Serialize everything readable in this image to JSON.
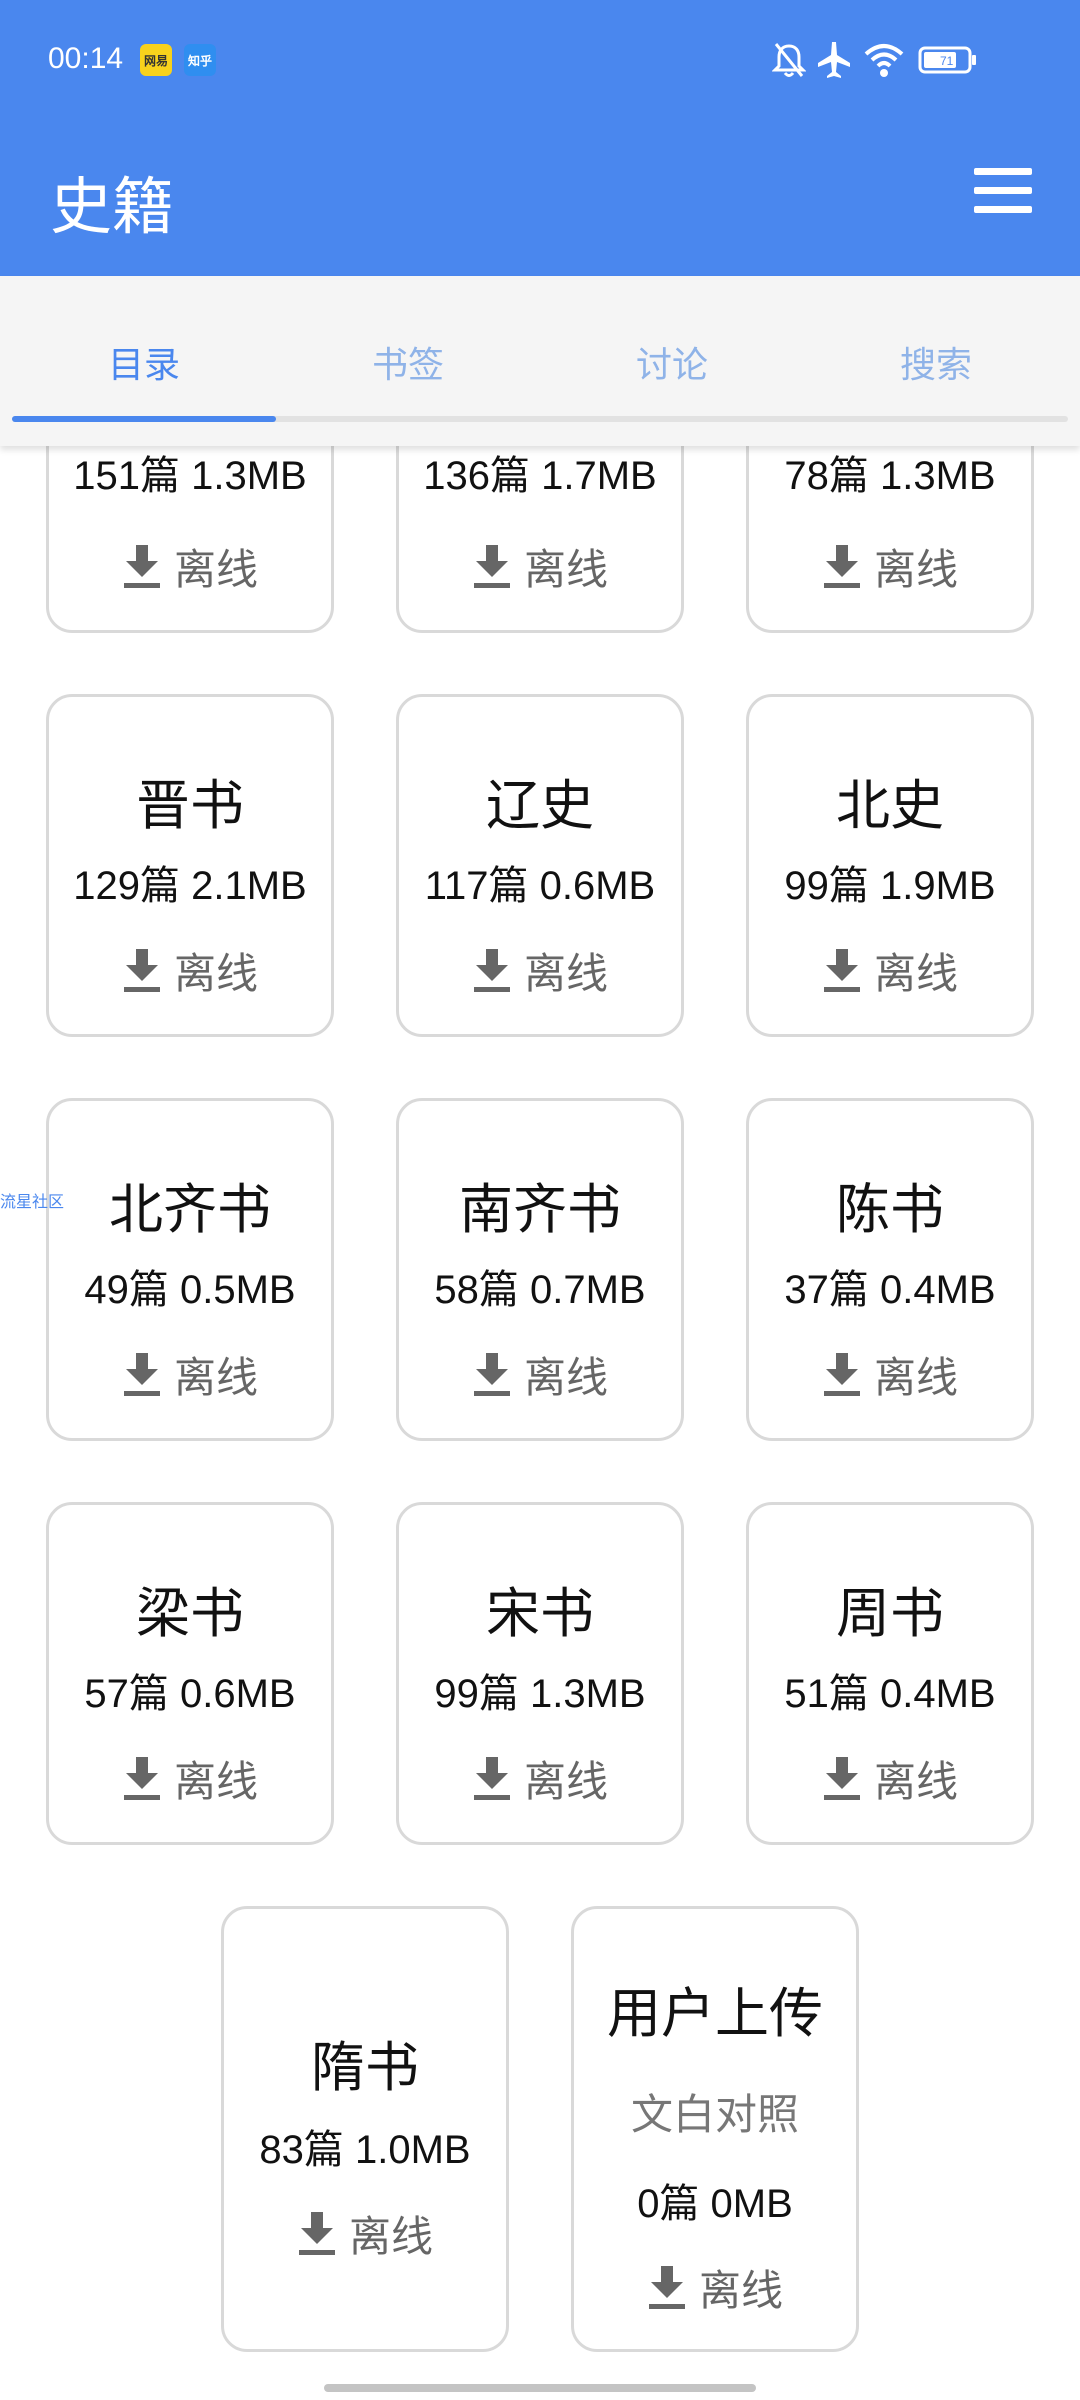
{
  "status_bar": {
    "time": "00:14",
    "app_icons": [
      "网易",
      "知乎"
    ],
    "battery": "71"
  },
  "header": {
    "title": "史籍",
    "menu_icon": "hamburger-icon"
  },
  "tabs": [
    {
      "label": "目录",
      "active": true
    },
    {
      "label": "书签",
      "active": false
    },
    {
      "label": "讨论",
      "active": false
    },
    {
      "label": "搜索",
      "active": false
    }
  ],
  "side_label": "流星社区",
  "download_label": "离线",
  "books": [
    {
      "name": "",
      "meta": "151篇 1.3MB"
    },
    {
      "name": "",
      "meta": "136篇 1.7MB"
    },
    {
      "name": "",
      "meta": "78篇 1.3MB"
    },
    {
      "name": "晋书",
      "meta": "129篇 2.1MB"
    },
    {
      "name": "辽史",
      "meta": "117篇 0.6MB"
    },
    {
      "name": "北史",
      "meta": "99篇 1.9MB"
    },
    {
      "name": "北齐书",
      "meta": "49篇 0.5MB"
    },
    {
      "name": "南齐书",
      "meta": "58篇 0.7MB"
    },
    {
      "name": "陈书",
      "meta": "37篇 0.4MB"
    },
    {
      "name": "梁书",
      "meta": "57篇 0.6MB"
    },
    {
      "name": "宋书",
      "meta": "99篇 1.3MB"
    },
    {
      "name": "周书",
      "meta": "51篇 0.4MB"
    },
    {
      "name": "隋书",
      "meta": "83篇 1.0MB"
    },
    {
      "name": "用户上传",
      "sub": "文白对照",
      "meta": "0篇 0MB"
    }
  ]
}
